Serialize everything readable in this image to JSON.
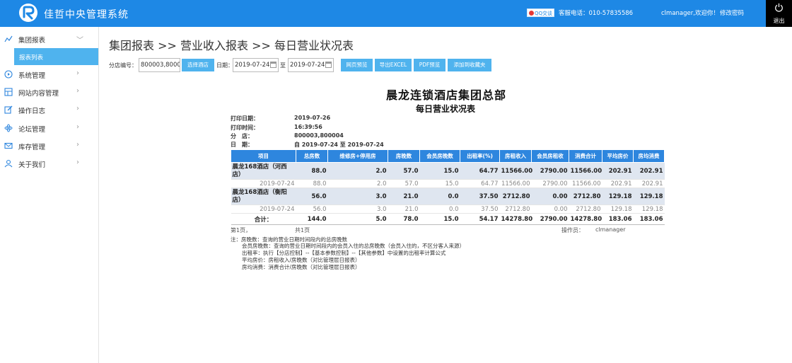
{
  "header": {
    "app_title": "佳哲中央管理系统",
    "qq_label": "QQ交谈",
    "hotline": "客服电话：010-57835586",
    "welcome": "clmanager,欢迎你！",
    "change_password": "修改密码",
    "logout": "退出"
  },
  "sidebar": {
    "items": [
      {
        "label": "集团报表",
        "icon": "chart-icon"
      },
      {
        "label": "系统管理",
        "icon": "play-circle-icon"
      },
      {
        "label": "网站内容管理",
        "icon": "grid-icon"
      },
      {
        "label": "操作日志",
        "icon": "edit-icon"
      },
      {
        "label": "论坛管理",
        "icon": "atom-icon"
      },
      {
        "label": "库存管理",
        "icon": "mail-icon"
      },
      {
        "label": "关于我们",
        "icon": "user-icon"
      }
    ],
    "sub_item": "报表列表"
  },
  "breadcrumb": "集团报表 >> 营业收入报表 >> 每日营业状况表",
  "toolbar": {
    "store_label": "分店编号：",
    "store_value": "800003,800004",
    "select_store_btn": "选择酒店",
    "date_label": "日期：",
    "date_from": "2019-07-24",
    "to_label": "至",
    "date_to": "2019-07-24",
    "btn_preview": "网页预览",
    "btn_excel": "导出EXCEL",
    "btn_pdf": "PDF预览",
    "btn_favorite": "添加到收藏夹"
  },
  "report": {
    "company": "晨龙连锁酒店集团总部",
    "title": "每日营业状况表",
    "meta": [
      {
        "label": "打印日期：",
        "value": "2019-07-26"
      },
      {
        "label": "打印时间：",
        "value": "16:39:56"
      },
      {
        "label": "分　店：",
        "value": "800003,800004"
      },
      {
        "label": "日　期：",
        "value": "自 2019-07-24 至 2019-07-24"
      }
    ],
    "columns": [
      "项目",
      "总房数",
      "维修房+停用房",
      "房晚数",
      "会员房晚数",
      "出租率(%)",
      "房租收入",
      "会员房租收",
      "消费合计",
      "平均房价",
      "房均消费"
    ],
    "rows": [
      {
        "type": "store",
        "cells": [
          "晨龙168酒店（河西店）",
          "88.0",
          "2.0",
          "57.0",
          "15.0",
          "64.77",
          "11566.00",
          "2790.00",
          "11566.00",
          "202.91",
          "202.91"
        ]
      },
      {
        "type": "day",
        "cells": [
          "2019-07-24",
          "88.0",
          "2.0",
          "57.0",
          "15.0",
          "64.77",
          "11566.00",
          "2790.00",
          "11566.00",
          "202.91",
          "202.91"
        ]
      },
      {
        "type": "store",
        "cells": [
          "晨龙168酒店（衡阳店）",
          "56.0",
          "3.0",
          "21.0",
          "0.0",
          "37.50",
          "2712.80",
          "0.00",
          "2712.80",
          "129.18",
          "129.18"
        ]
      },
      {
        "type": "day",
        "cells": [
          "2019-07-24",
          "56.0",
          "3.0",
          "21.0",
          "0.0",
          "37.50",
          "2712.80",
          "0.00",
          "2712.80",
          "129.18",
          "129.18"
        ]
      },
      {
        "type": "total",
        "cells": [
          "合计：",
          "144.0",
          "5.0",
          "78.0",
          "15.0",
          "54.17",
          "14278.80",
          "2790.00",
          "14278.80",
          "183.06",
          "183.06"
        ]
      }
    ],
    "page_current": "第1页，",
    "page_total": "共1页",
    "operator_label": "操作员：",
    "operator": "clmanager",
    "notes": [
      "注：房晚数：查询的营业日期时间段内的总房晚数",
      "会员房晚数：查询的营业日期时间段内的会员入住的总房晚数（会员入住的，不区分客人来源）",
      "出租率：执行【分店控制】--【基本参数控制】--【其他参数】中设置的出租率计算公式",
      "平均房价：房租收入/房晚数（对比管理层日报表）",
      "房均消费：消费合计/房晚数（对比管理层日报表）"
    ]
  }
}
